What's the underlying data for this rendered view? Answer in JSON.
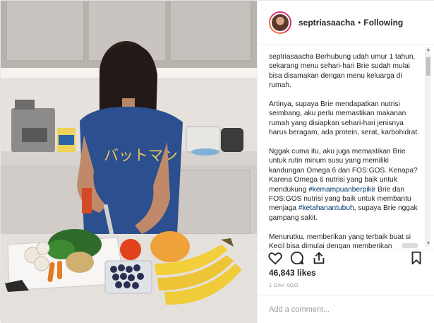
{
  "post": {
    "username": "septriasaacha",
    "separator": "•",
    "follow_label": "Following",
    "caption": {
      "user": "septriasaacha",
      "para1": "Berhubung udah umur 1 tahun, sekarang menu sehari-hari Brie sudah mulai bisa disamakan dengan menu keluarga di rumah.",
      "para2": "Artinya, supaya Brie mendapatkan nutrisi seimbang, aku perlu memastikan makanan rumah yang disiapkan sehari-hari jenisnya harus beragam, ada protein, serat, karbohidrat.",
      "para3_a": "Nggak cuma itu, aku juga memastikan Brie untuk rutin minum susu yang memiliki kandungan Omega 6 dan FOS:GOS. Kenapa? Karena Omega 6 nutrisi yang baik untuk mendukung ",
      "hashtag1": "#kemampuanberpikir",
      "para3_b": " Brie dan FOS:GOS nutrisi yang baik untuk membantu menjaga ",
      "hashtag2": "#ketahanantubuh",
      "para3_c": ", supaya Brie nggak gampang sakit.",
      "para4": "Menurutku, memberikan yang terbaik buat si Kecil bisa dimulai dengan memberikan makanan yang terbaik"
    },
    "likes": "46,843 likes",
    "date": "1 DAY AGO",
    "comment_placeholder": "Add a comment...",
    "photo_text": "バットマン"
  },
  "icons": {
    "like": "heart-icon",
    "comment": "comment-icon",
    "share": "share-icon",
    "save": "bookmark-icon"
  },
  "colors": {
    "link": "#003569",
    "text": "#262626",
    "muted": "#999999"
  }
}
